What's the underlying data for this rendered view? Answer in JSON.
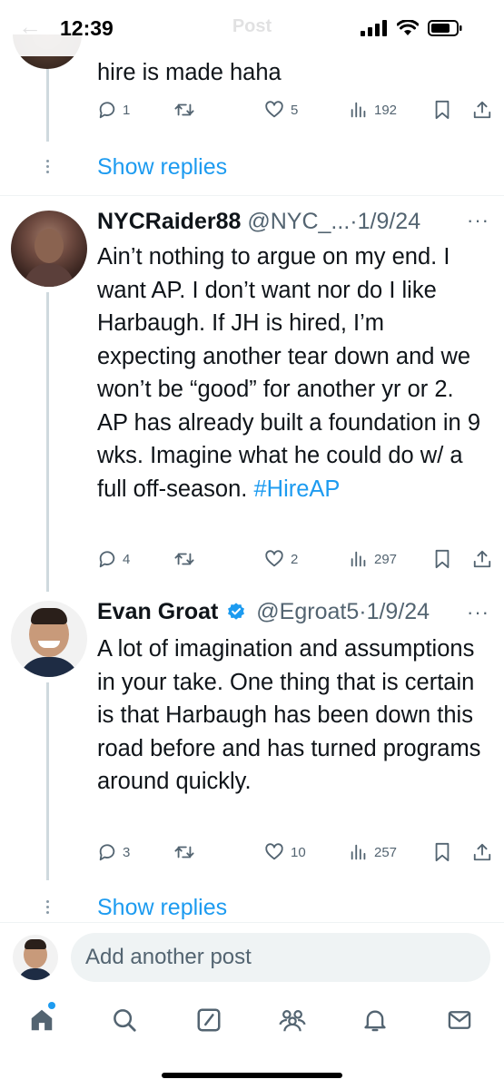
{
  "status_bar": {
    "time": "12:39",
    "faded_title": "Post"
  },
  "reply_top": {
    "text_tail": "hire is made haha",
    "actions": {
      "replies": "1",
      "reposts": "",
      "likes": "5",
      "views": "192"
    },
    "show_replies": "Show replies"
  },
  "reply_nycraider": {
    "display_name": "NYCRaider88",
    "handle": "@NYC_...",
    "sep": "·",
    "date": "1/9/24",
    "more": "···",
    "text": "Ain’t nothing to argue on my end. I want AP. I don’t want nor do I like Harbaugh. If JH is hired, I’m expecting another tear down and we won’t be “good” for another yr or 2. AP has already built a foundation in 9 wks. Imagine what he could do w/ a full off-season.",
    "hashtag": "#HireAP",
    "actions": {
      "replies": "4",
      "reposts": "",
      "likes": "2",
      "views": "297"
    }
  },
  "reply_evan": {
    "display_name": "Evan Groat",
    "handle": "@Egroat5",
    "sep": "·",
    "date": "1/9/24",
    "more": "···",
    "text": "A lot of imagination and assumptions in your take. One thing that is certain is that Harbaugh has been down this road before and has turned programs around quickly.",
    "actions": {
      "replies": "3",
      "reposts": "",
      "likes": "10",
      "views": "257"
    },
    "show_replies": "Show replies"
  },
  "compose": {
    "placeholder": "Add another post"
  },
  "tab_bar": {
    "items": [
      "home-icon",
      "search-icon",
      "grok-icon",
      "communities-icon",
      "notifications-icon",
      "messages-icon"
    ]
  },
  "colors": {
    "accent": "#1d9bf0",
    "text": "#0f1419",
    "secondary": "#536471",
    "verified": "#1d9bf0"
  }
}
